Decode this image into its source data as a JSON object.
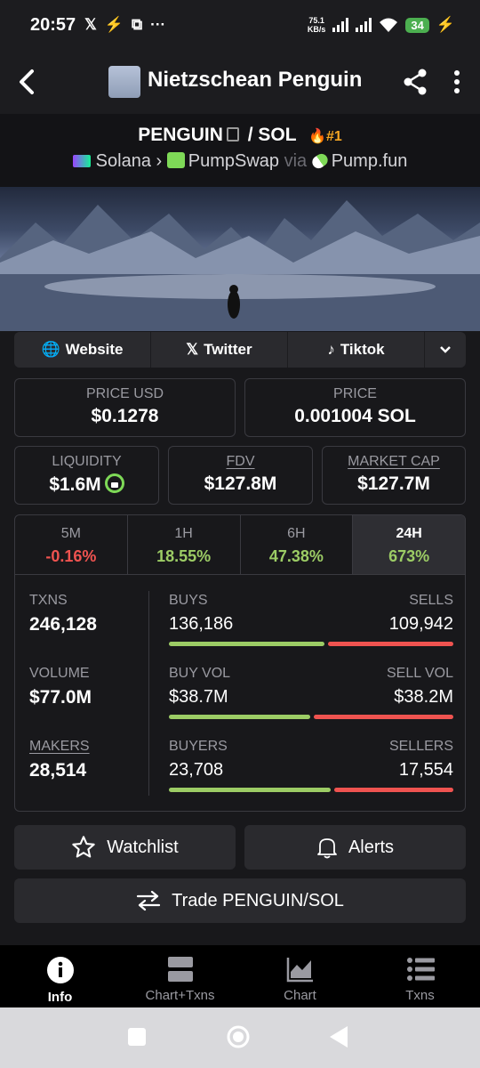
{
  "status": {
    "time": "20:57",
    "net_speed_value": "75.1",
    "net_speed_unit": "KB/s",
    "battery": "34"
  },
  "header": {
    "title": "Nietzschean Penguin"
  },
  "pair": {
    "base": "PENGUIN",
    "separator": "/",
    "quote": "SOL",
    "rank": "#1",
    "chain": "Solana",
    "dex": "PumpSwap",
    "via": "via",
    "launchpad": "Pump.fun"
  },
  "links": {
    "website": "Website",
    "twitter": "Twitter",
    "tiktok": "Tiktok"
  },
  "price": {
    "usd_label": "PRICE USD",
    "usd_value": "$0.1278",
    "native_label": "PRICE",
    "native_value": "0.001004 SOL"
  },
  "metrics": {
    "liquidity_label": "LIQUIDITY",
    "liquidity_value": "$1.6M",
    "fdv_label": "FDV",
    "fdv_value": "$127.8M",
    "mcap_label": "MARKET CAP",
    "mcap_value": "$127.7M"
  },
  "timeframes": [
    {
      "label": "5M",
      "change": "-0.16%"
    },
    {
      "label": "1H",
      "change": "18.55%"
    },
    {
      "label": "6H",
      "change": "47.38%"
    },
    {
      "label": "24H",
      "change": "673%"
    }
  ],
  "stats": {
    "txns_label": "TXNS",
    "txns_value": "246,128",
    "volume_label": "VOLUME",
    "volume_value": "$77.0M",
    "makers_label": "MAKERS",
    "makers_value": "28,514",
    "buys_label": "BUYS",
    "buys_value": "136,186",
    "sells_label": "SELLS",
    "sells_value": "109,942",
    "buy_vol_label": "BUY VOL",
    "buy_vol_value": "$38.7M",
    "sell_vol_label": "SELL VOL",
    "sell_vol_value": "$38.2M",
    "buyers_label": "BUYERS",
    "buyers_value": "23,708",
    "sellers_label": "SELLERS",
    "sellers_value": "17,554",
    "buys_share": 0.553,
    "buy_vol_share": 0.503,
    "buyers_share": 0.575
  },
  "actions": {
    "watchlist": "Watchlist",
    "alerts": "Alerts",
    "trade": "Trade PENGUIN/SOL"
  },
  "nav": {
    "info": "Info",
    "chart_txns": "Chart+Txns",
    "chart": "Chart",
    "txns": "Txns"
  },
  "colors": {
    "positive": "#9ccc65",
    "negative": "#ef5350",
    "rank": "#f5a623"
  }
}
